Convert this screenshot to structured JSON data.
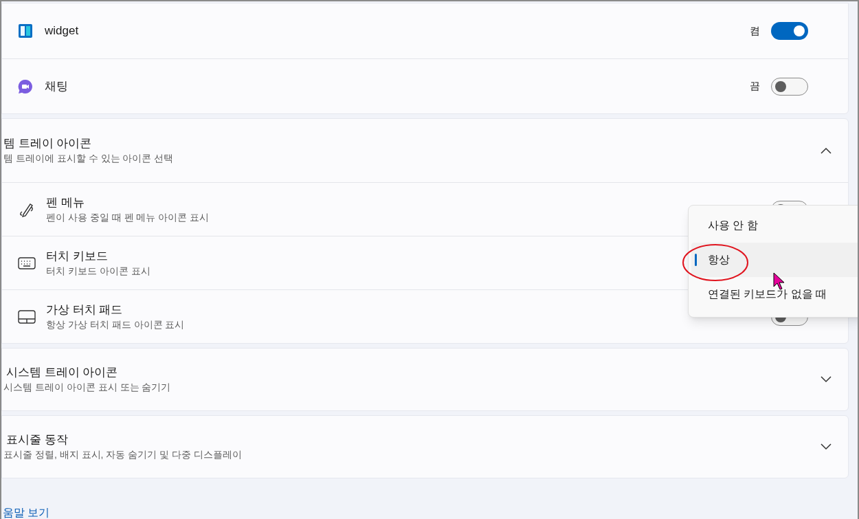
{
  "top_card": {
    "rows": [
      {
        "kind": "widget",
        "label": "widget",
        "state_text": "켬",
        "on": true
      },
      {
        "kind": "chat",
        "label": "채팅",
        "state_text": "끔",
        "on": false
      }
    ]
  },
  "tray_icons": {
    "title": "템 트레이 아이콘",
    "subtitle": "템 트레이에 표시할 수 있는 아이콘 선택",
    "expanded": true,
    "items": [
      {
        "kind": "pen",
        "label": "펜 메뉴",
        "description": "펜이 사용 중일 때 펜 메뉴 아이콘 표시",
        "on": false
      },
      {
        "kind": "keyboard",
        "label": "터치 키보드",
        "description": "터치 키보드 아이콘 표시"
      },
      {
        "kind": "touchpad",
        "label": "가상 터치 패드",
        "description": "항상 가상 터치 패드 아이콘 표시",
        "on": false
      }
    ]
  },
  "dropdown": {
    "options": [
      {
        "label": "사용 안 함",
        "selected": false
      },
      {
        "label": "항상",
        "selected": true
      },
      {
        "label": "연결된 키보드가 없을 때",
        "selected": false
      }
    ]
  },
  "sections": [
    {
      "title": "시스템 트레이 아이콘",
      "subtitle": "시스템 트레이 아이콘 표시 또는 숨기기",
      "expanded": false
    },
    {
      "title": "표시줄 동작",
      "subtitle": "표시줄 정렬, 배지 표시, 자동 숨기기 및 다중 디스플레이",
      "expanded": false
    }
  ],
  "help_link": "움말 보기"
}
